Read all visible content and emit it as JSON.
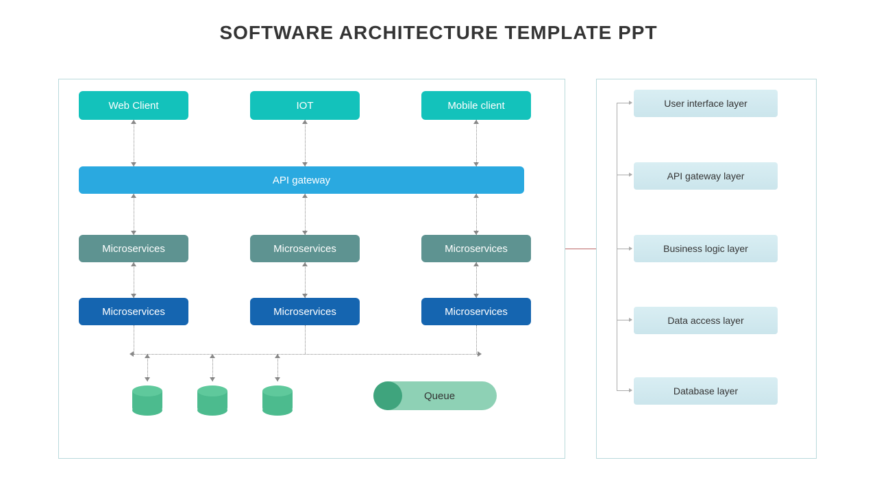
{
  "title": "SOFTWARE ARCHITECTURE TEMPLATE PPT",
  "clients": [
    "Web Client",
    "IOT",
    "Mobile client"
  ],
  "api": "API gateway",
  "micro_a": [
    "Microservices",
    "Microservices",
    "Microservices"
  ],
  "micro_b": [
    "Microservices",
    "Microservices",
    "Microservices"
  ],
  "queue": "Queue",
  "layers": [
    "User interface layer",
    "API gateway layer",
    "Business logic layer",
    "Data access layer",
    "Database layer"
  ]
}
